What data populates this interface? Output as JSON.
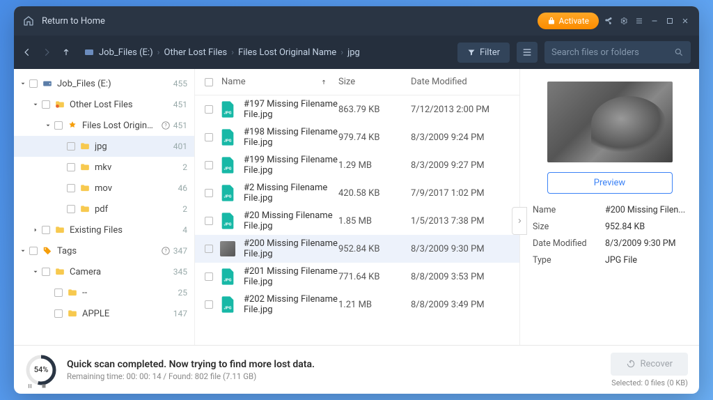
{
  "titlebar": {
    "return_home": "Return to Home",
    "activate": "Activate"
  },
  "toolbar": {
    "breadcrumb": [
      "Job_Files (E:)",
      "Other Lost Files",
      "Files Lost Original Name",
      "jpg"
    ],
    "filter": "Filter",
    "search_placeholder": "Search files or folders"
  },
  "tree": [
    {
      "indent": 0,
      "caret": "down",
      "icon": "drive",
      "label": "Job_Files (E:)",
      "count": "455"
    },
    {
      "indent": 1,
      "caret": "down",
      "icon": "folder-warn",
      "label": "Other Lost Files",
      "count": "451"
    },
    {
      "indent": 2,
      "caret": "down",
      "icon": "star-folder",
      "label": "Files Lost Origina...",
      "count": "451",
      "help": true
    },
    {
      "indent": 3,
      "caret": "none",
      "icon": "folder",
      "label": "jpg",
      "count": "401",
      "sel": true
    },
    {
      "indent": 3,
      "caret": "none",
      "icon": "folder",
      "label": "mkv",
      "count": "2"
    },
    {
      "indent": 3,
      "caret": "none",
      "icon": "folder",
      "label": "mov",
      "count": "46"
    },
    {
      "indent": 3,
      "caret": "none",
      "icon": "folder",
      "label": "pdf",
      "count": "2"
    },
    {
      "indent": 1,
      "caret": "right",
      "icon": "folder",
      "label": "Existing Files",
      "count": "4"
    },
    {
      "indent": 0,
      "caret": "down",
      "icon": "tag",
      "label": "Tags",
      "count": "347",
      "help": true
    },
    {
      "indent": 1,
      "caret": "down",
      "icon": "folder",
      "label": "Camera",
      "count": "345"
    },
    {
      "indent": 2,
      "caret": "none",
      "icon": "folder",
      "label": "--",
      "count": "25"
    },
    {
      "indent": 2,
      "caret": "none",
      "icon": "folder",
      "label": "APPLE",
      "count": "147"
    }
  ],
  "columns": {
    "name": "Name",
    "size": "Size",
    "date": "Date Modified"
  },
  "files": [
    {
      "name": "#197 Missing Filename File.jpg",
      "size": "863.79 KB",
      "date": "7/12/2013 2:00 PM"
    },
    {
      "name": "#198 Missing Filename File.jpg",
      "size": "979.74 KB",
      "date": "8/3/2009 9:24 PM"
    },
    {
      "name": "#199 Missing Filename File.jpg",
      "size": "1.29 MB",
      "date": "8/3/2009 9:27 PM"
    },
    {
      "name": "#2 Missing Filename File.jpg",
      "size": "420.58 KB",
      "date": "7/9/2017 1:02 PM"
    },
    {
      "name": "#20 Missing Filename File.jpg",
      "size": "1.85 MB",
      "date": "1/5/2013 7:38 PM"
    },
    {
      "name": "#200 Missing Filename File.jpg",
      "size": "952.84 KB",
      "date": "8/3/2009 9:30 PM",
      "sel": true,
      "thumb": true
    },
    {
      "name": "#201 Missing Filename File.jpg",
      "size": "771.64 KB",
      "date": "8/8/2009 3:53 PM"
    },
    {
      "name": "#202 Missing Filename File.jpg",
      "size": "1.21 MB",
      "date": "8/8/2009 3:49 PM"
    }
  ],
  "preview": {
    "button": "Preview",
    "labels": {
      "name": "Name",
      "size": "Size",
      "date": "Date Modified",
      "type": "Type"
    },
    "values": {
      "name": "#200 Missing Filen...",
      "size": "952.84 KB",
      "date": "8/3/2009 9:30 PM",
      "type": "JPG File"
    }
  },
  "footer": {
    "percent": "54%",
    "status_main": "Quick scan completed. Now trying to find more lost data.",
    "status_sub": "Remaining time: 00: 00: 14 / Found: 802 file (7.11 GB)",
    "recover": "Recover",
    "selected": "Selected: 0 files (0 KB)"
  }
}
